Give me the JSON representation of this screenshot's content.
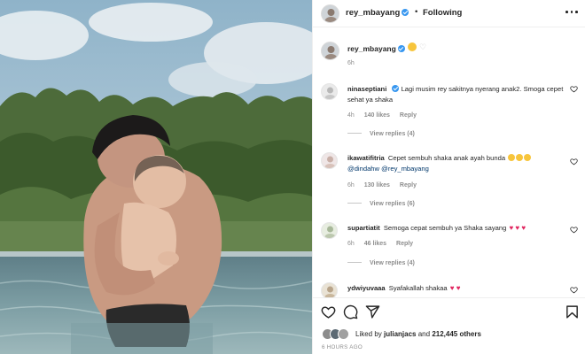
{
  "header": {
    "username": "rey_mbayang",
    "separator": "•",
    "follow_status": "Following",
    "more_icon": "more-options-icon"
  },
  "caption": {
    "username": "rey_mbayang",
    "time": "6h"
  },
  "comments": [
    {
      "username": "ninaseptiani",
      "text": "Lagi musim rey sakitnya nyerang anak2. Smoga cepet sehat ya shaka",
      "time": "4h",
      "likes": "140 likes",
      "reply": "Reply",
      "view_replies": "View replies (4)"
    },
    {
      "username": "ikawatifitria",
      "text_before": "Cepet sembuh shaka anak ayah bunda",
      "mention1": "@dindahw",
      "mention2": "@rey_mbayang",
      "time": "6h",
      "likes": "130 likes",
      "reply": "Reply",
      "view_replies": "View replies (6)"
    },
    {
      "username": "supartiatit",
      "text": "Semoga cepat sembuh ya Shaka sayang",
      "hearts": "♥ ♥ ♥",
      "time": "6h",
      "likes": "46 likes",
      "reply": "Reply",
      "view_replies": "View replies (4)"
    },
    {
      "username": "ydwiyuvaaa",
      "text": "Syafakallah shakaa",
      "hearts": "♥ ♥"
    }
  ],
  "actions": {
    "like_icon": "heart-icon",
    "comment_icon": "comment-icon",
    "share_icon": "share-icon",
    "save_icon": "bookmark-icon"
  },
  "likes": {
    "prefix": "Liked by",
    "user": "julianjacs",
    "middle": "and",
    "count": "212,445 others"
  },
  "post_time": "6 HOURS AGO",
  "colors": {
    "verified": "#3897f0",
    "link": "#00376b",
    "heart": "#e0245e",
    "muted": "#8e8e8e"
  }
}
